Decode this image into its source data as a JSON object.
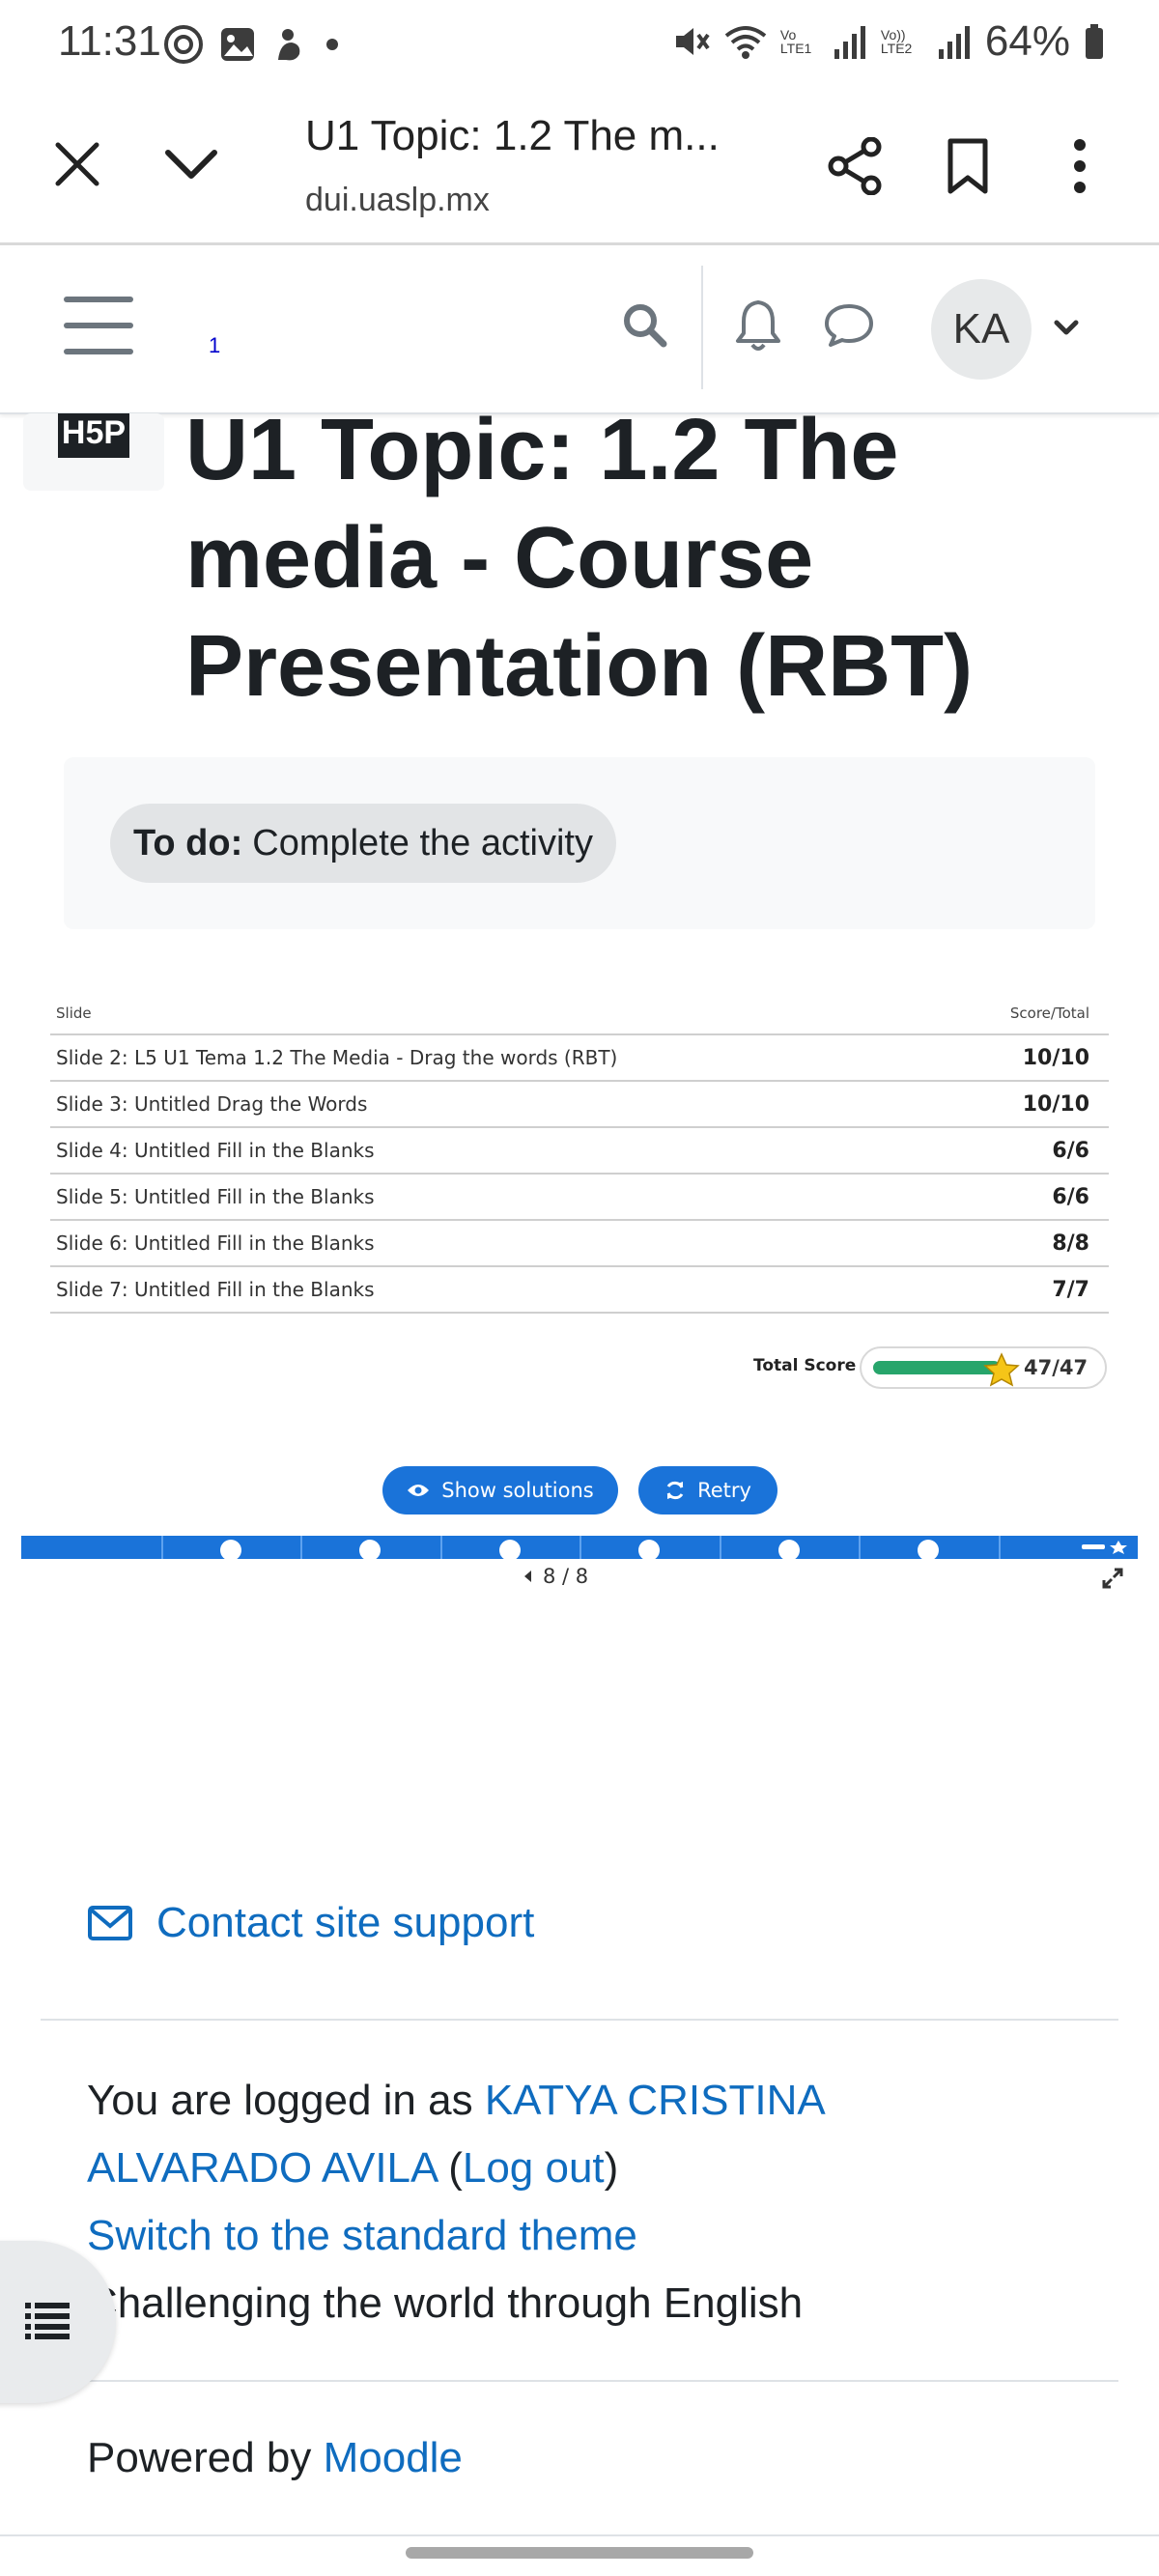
{
  "status_bar": {
    "time": "11:31",
    "battery_percent": "64%",
    "icons_left": [
      "threads-icon",
      "gallery-icon",
      "app-icon",
      "dot-icon"
    ],
    "icons_right": [
      "mute-icon",
      "wifi-icon",
      "signal-lte1-icon",
      "signal-lte2-icon",
      "battery-icon"
    ],
    "lte1_label": "Vo LTE1",
    "lte2_label": "Vo)) LTE2"
  },
  "browser": {
    "title": "U1 Topic: 1.2 The m...",
    "url": "dui.uaslp.mx"
  },
  "navbar": {
    "badge": "1",
    "avatar_initials": "KA"
  },
  "page": {
    "logo_text": "H5P",
    "title": "U1 Topic: 1.2 The media - Course Presentation (RBT)",
    "todo_label": "To do:",
    "todo_text": "Complete the activity"
  },
  "summary": {
    "col_slide": "Slide",
    "col_score": "Score/Total",
    "rows": [
      {
        "slide": "Slide 2: L5 U1 Tema 1.2 The Media - Drag the words (RBT)",
        "score": "10/10"
      },
      {
        "slide": "Slide 3: Untitled Drag the Words",
        "score": "10/10"
      },
      {
        "slide": "Slide 4: Untitled Fill in the Blanks",
        "score": "6/6"
      },
      {
        "slide": "Slide 5: Untitled Fill in the Blanks",
        "score": "6/6"
      },
      {
        "slide": "Slide 6: Untitled Fill in the Blanks",
        "score": "8/8"
      },
      {
        "slide": "Slide 7: Untitled Fill in the Blanks",
        "score": "7/7"
      }
    ],
    "total_label": "Total Score",
    "total_score": "47/47",
    "total_fraction": 1.0,
    "show_solutions_label": "Show solutions",
    "retry_label": "Retry",
    "pagination": "8 / 8",
    "slide_count": 8,
    "current_slide": 8
  },
  "footer": {
    "support_label": "Contact site support",
    "logged_in_prefix": "You are logged in as",
    "user_name": "KATYA CRISTINA ALVARADO AVILA",
    "logout_open": "(",
    "logout_label": "Log out",
    "logout_close": ")",
    "switch_theme_label": "Switch to the standard theme",
    "site_name": "Challenging the world through English",
    "powered_prefix": "Powered by",
    "powered_link": "Moodle"
  },
  "colors": {
    "link": "#0f6cbf",
    "h5p_blue": "#1a73d9",
    "score_green": "#27a56b",
    "star_gold": "#f5c518"
  }
}
